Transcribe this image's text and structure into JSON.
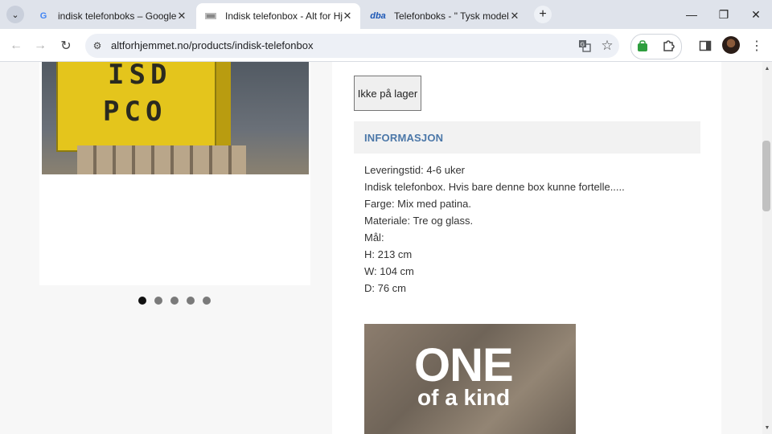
{
  "browser": {
    "tabs": [
      {
        "title": "indisk telefonboks – Google S",
        "favicon": "google-icon"
      },
      {
        "title": "Indisk telefonbox - Alt for Hjem",
        "favicon": "site-icon"
      },
      {
        "title": "Telefonboks - \" Tysk model... -",
        "favicon": "dba",
        "favicon_text": "dba"
      }
    ],
    "url": "altforhjemmet.no/products/indisk-telefonbox"
  },
  "product": {
    "stock_button": "Ikke på lager",
    "image_lettering": [
      "ISD",
      "PCO"
    ],
    "gallery_dots": 5,
    "active_dot": 0
  },
  "info": {
    "heading": "INFORMASJON",
    "lines": [
      "Leveringstid: 4-6 uker",
      "Indisk telefonbox. Hvis bare denne box kunne fortelle.....",
      "Farge: Mix med patina.",
      "Materiale: Tre og glass.",
      "Mål:",
      "H: 213 cm",
      "W: 104 cm",
      "D: 76 cm"
    ]
  },
  "promo": {
    "big": "ONE",
    "small": "of a kind"
  },
  "colors": {
    "info_heading": "#4b77a8",
    "tabstrip": "#dfe3eb"
  }
}
